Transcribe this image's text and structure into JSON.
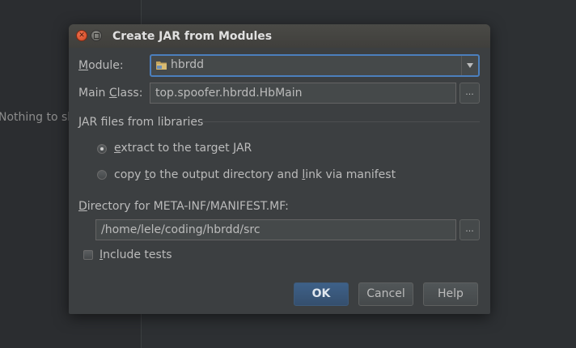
{
  "background": {
    "empty_text": "Nothing to sh"
  },
  "dialog": {
    "title": "Create JAR from Modules",
    "module": {
      "label_prefix": "M",
      "label_rest": "odule:",
      "value": "hbrdd"
    },
    "main_class": {
      "label_pre": "Main ",
      "label_u": "C",
      "label_post": "lass:",
      "value": "top.spoofer.hbrdd.HbMain",
      "browse_label": "..."
    },
    "libraries": {
      "section_title": "JAR files from libraries",
      "option_extract": {
        "u": "e",
        "rest": "xtract to the target JAR",
        "selected": true
      },
      "option_copy": {
        "pre": "copy ",
        "u1": "t",
        "mid": "o the output directory and ",
        "u2": "l",
        "post": "ink via manifest",
        "selected": false
      }
    },
    "manifest": {
      "label_u": "D",
      "label_rest": "irectory for META-INF/MANIFEST.MF:",
      "value": "/home/lele/coding/hbrdd/src",
      "browse_label": "..."
    },
    "include_tests": {
      "u": "I",
      "rest": "nclude tests",
      "checked": false
    },
    "buttons": {
      "ok": "OK",
      "cancel": "Cancel",
      "help": "Help"
    }
  },
  "colors": {
    "accent_focus": "#4b7fbd",
    "ok_button": "#3e6189",
    "dialog_bg": "#3c3f41",
    "close_button": "#e05a35"
  }
}
